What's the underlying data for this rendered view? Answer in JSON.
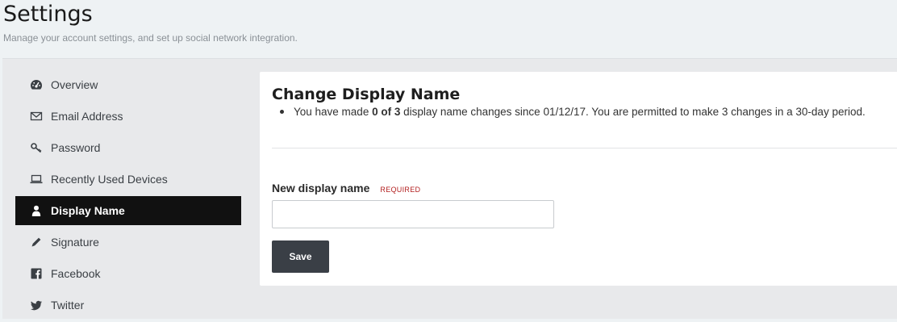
{
  "header": {
    "title": "Settings",
    "subtitle": "Manage your account settings, and set up social network integration."
  },
  "sidebar": {
    "items": [
      {
        "label": "Overview",
        "icon": "dashboard-icon",
        "active": false
      },
      {
        "label": "Email Address",
        "icon": "envelope-icon",
        "active": false
      },
      {
        "label": "Password",
        "icon": "key-icon",
        "active": false
      },
      {
        "label": "Recently Used Devices",
        "icon": "laptop-icon",
        "active": false
      },
      {
        "label": "Display Name",
        "icon": "user-icon",
        "active": true
      },
      {
        "label": "Signature",
        "icon": "pencil-icon",
        "active": false
      },
      {
        "label": "Facebook",
        "icon": "facebook-icon",
        "active": false
      },
      {
        "label": "Twitter",
        "icon": "twitter-icon",
        "active": false
      }
    ]
  },
  "panel": {
    "title": "Change Display Name",
    "note_prefix": "You have made ",
    "note_count": "0 of 3",
    "note_suffix": " display name changes since 01/12/17. You are permitted to make 3 changes in a 30-day period.",
    "field_label": "New display name",
    "required_tag": "REQUIRED",
    "input_value": "",
    "input_placeholder": "",
    "save_label": "Save"
  },
  "colors": {
    "page_bg": "#eef2f4",
    "content_bg": "#e8e9eb",
    "active_nav_bg": "#111111",
    "button_bg": "#3a3f46",
    "required": "#b32020"
  }
}
